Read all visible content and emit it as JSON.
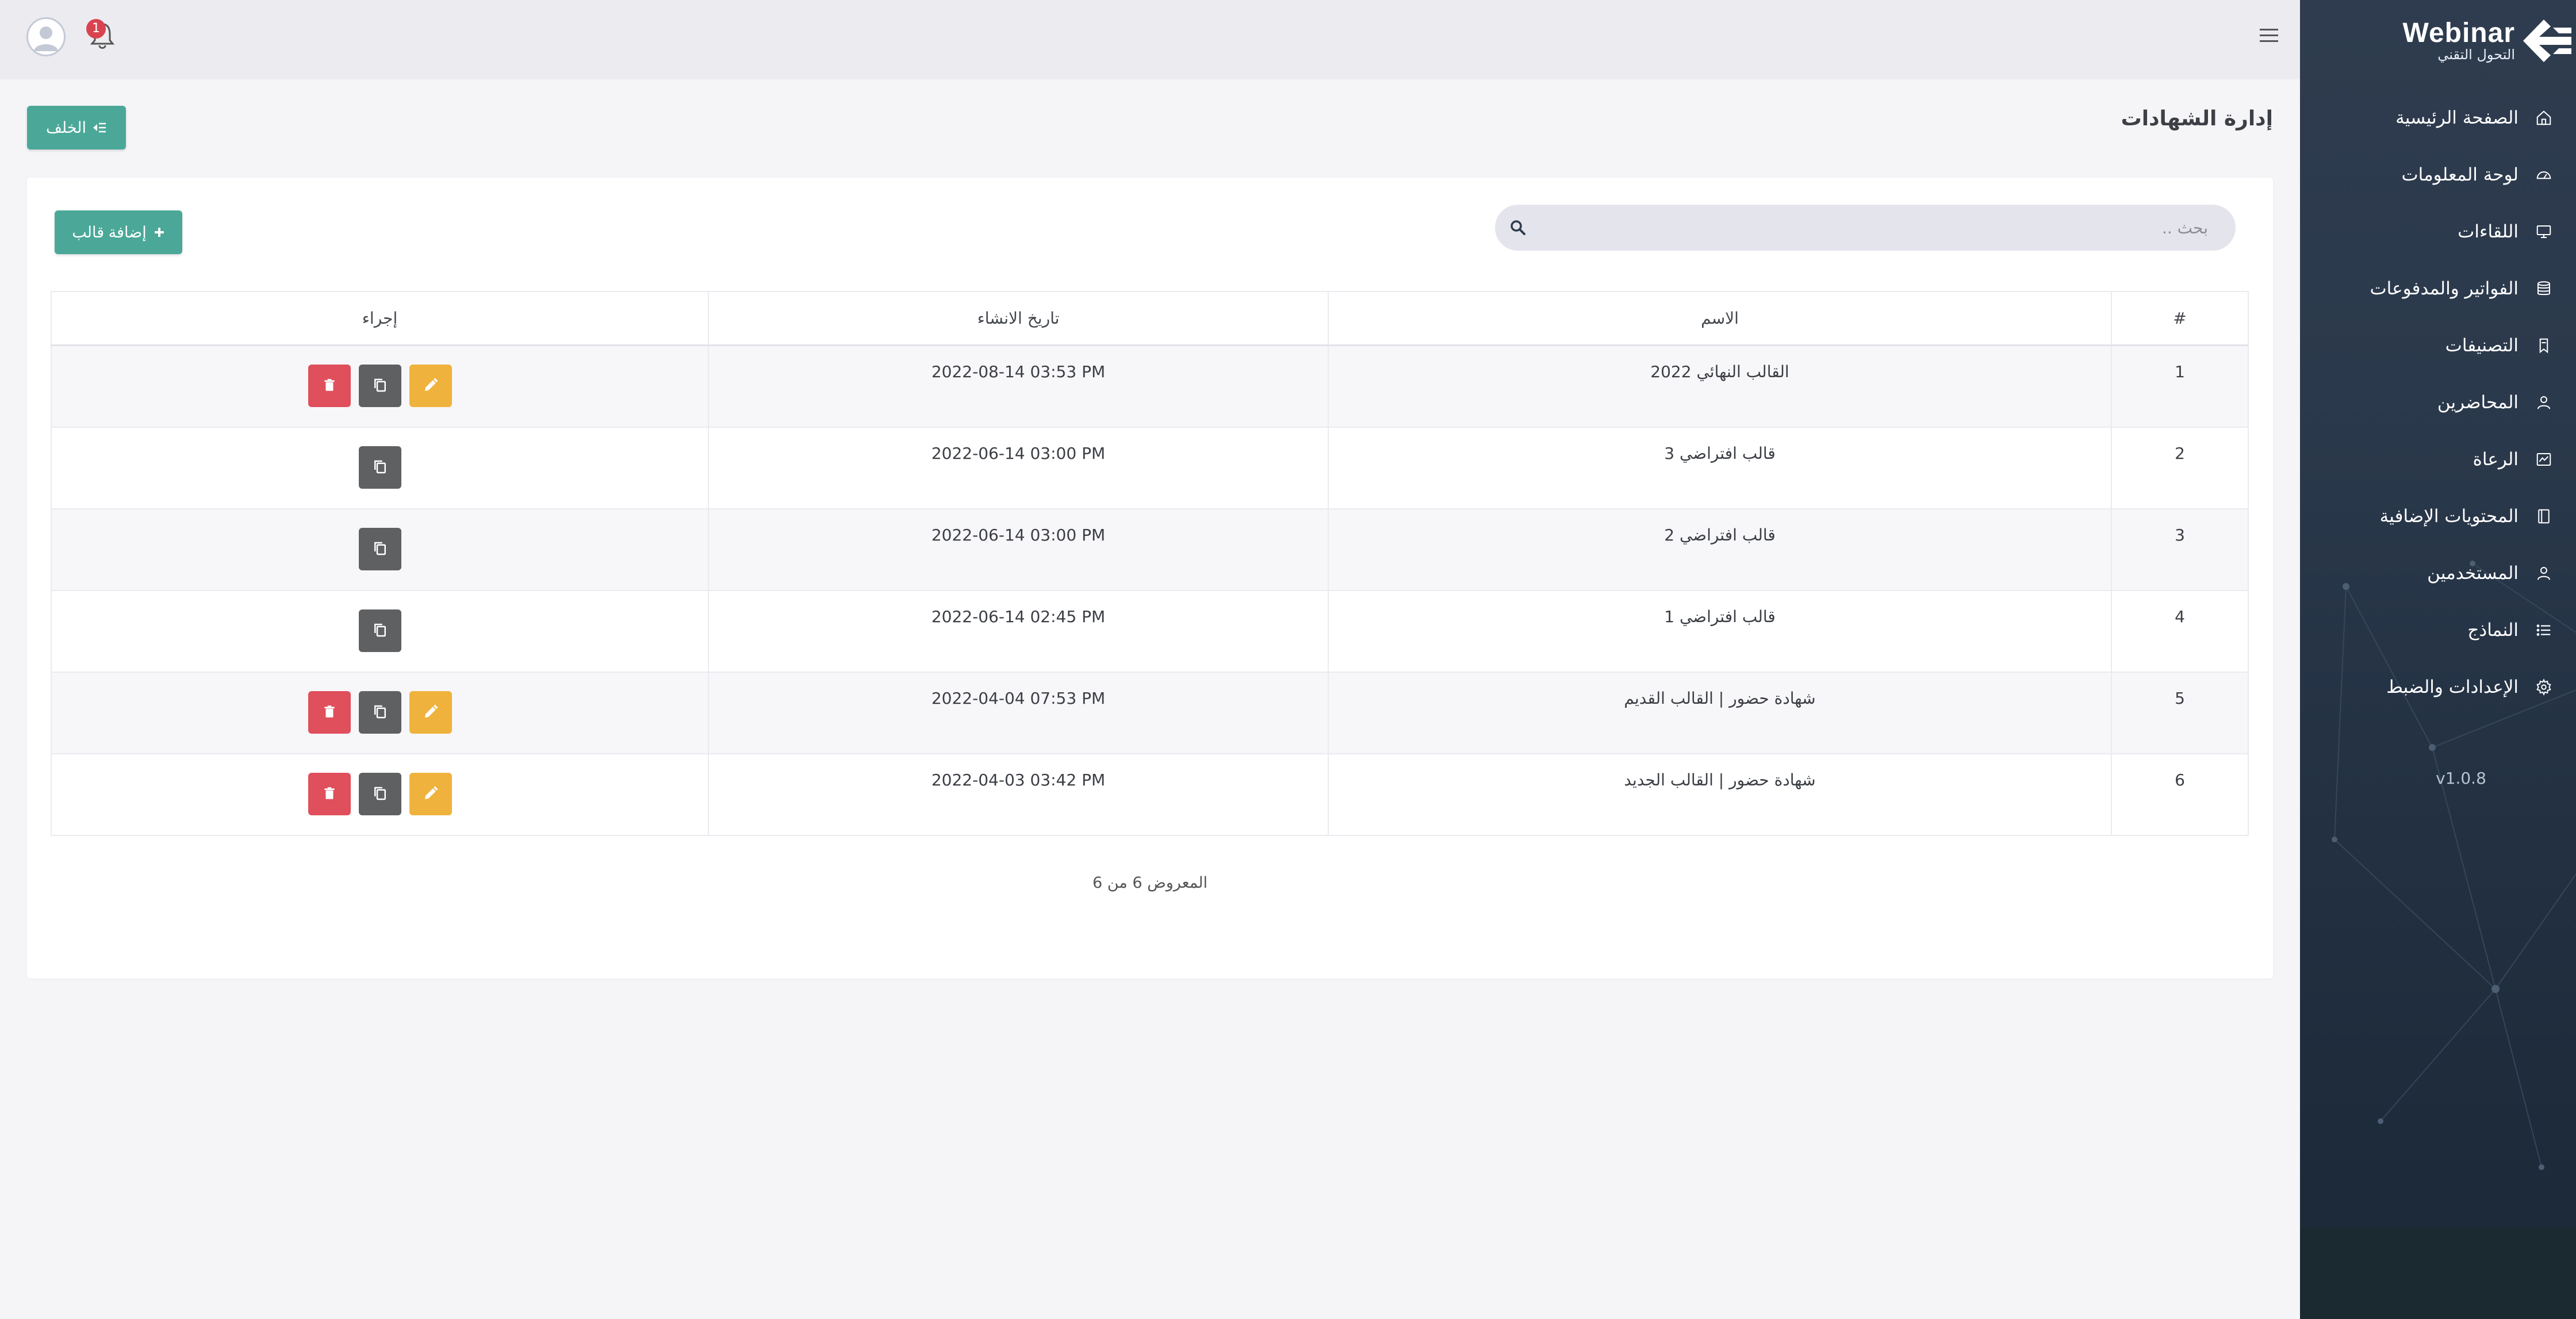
{
  "app": {
    "logo_title": "Webinar",
    "logo_subtitle": "التحول التقني",
    "version": "v1.0.8"
  },
  "sidebar": {
    "items": [
      {
        "label": "الصفحة الرئيسية",
        "icon": "home-icon"
      },
      {
        "label": "لوحة المعلومات",
        "icon": "dashboard-icon"
      },
      {
        "label": "اللقاءات",
        "icon": "monitor-icon"
      },
      {
        "label": "الفواتير والمدفوعات",
        "icon": "database-icon"
      },
      {
        "label": "التصنيفات",
        "icon": "bookmark-icon"
      },
      {
        "label": "المحاضرين",
        "icon": "user-icon"
      },
      {
        "label": "الرعاة",
        "icon": "sponsors-icon"
      },
      {
        "label": "المحتويات الإضافية",
        "icon": "book-icon"
      },
      {
        "label": "المستخدمين",
        "icon": "users-icon"
      },
      {
        "label": "النماذج",
        "icon": "list-icon"
      },
      {
        "label": "الإعدادات والضبط",
        "icon": "gear-icon"
      }
    ]
  },
  "header": {
    "notification_count": "1"
  },
  "page": {
    "title": "إدارة الشهادات",
    "back_label": "الخلف",
    "add_label": "إضافة قالب",
    "search_placeholder": "بحث .."
  },
  "table": {
    "headers": {
      "num": "#",
      "name": "الاسم",
      "date": "تاريخ الانشاء",
      "action": "إجراء"
    },
    "rows": [
      {
        "num": "1",
        "name": "القالب النهائي 2022",
        "date": "2022-08-14 03:53 PM",
        "actions": [
          "edit",
          "copy",
          "delete"
        ]
      },
      {
        "num": "2",
        "name": "قالب افتراضي 3",
        "date": "2022-06-14 03:00 PM",
        "actions": [
          "copy"
        ]
      },
      {
        "num": "3",
        "name": "قالب افتراضي 2",
        "date": "2022-06-14 03:00 PM",
        "actions": [
          "copy"
        ]
      },
      {
        "num": "4",
        "name": "قالب افتراضي 1",
        "date": "2022-06-14 02:45 PM",
        "actions": [
          "copy"
        ]
      },
      {
        "num": "5",
        "name": "شهادة حضور | القالب القديم",
        "date": "2022-04-04 07:53 PM",
        "actions": [
          "edit",
          "copy",
          "delete"
        ]
      },
      {
        "num": "6",
        "name": "شهادة حضور | القالب الجديد",
        "date": "2022-04-03 03:42 PM",
        "actions": [
          "edit",
          "copy",
          "delete"
        ]
      }
    ]
  },
  "pagination": {
    "summary": "المعروض 6 من 6"
  },
  "colors": {
    "primary": "#4ba898",
    "edit": "#efb33d",
    "copy": "#5f6062",
    "delete": "#e04f5c",
    "sidebar": "#2b394c"
  }
}
